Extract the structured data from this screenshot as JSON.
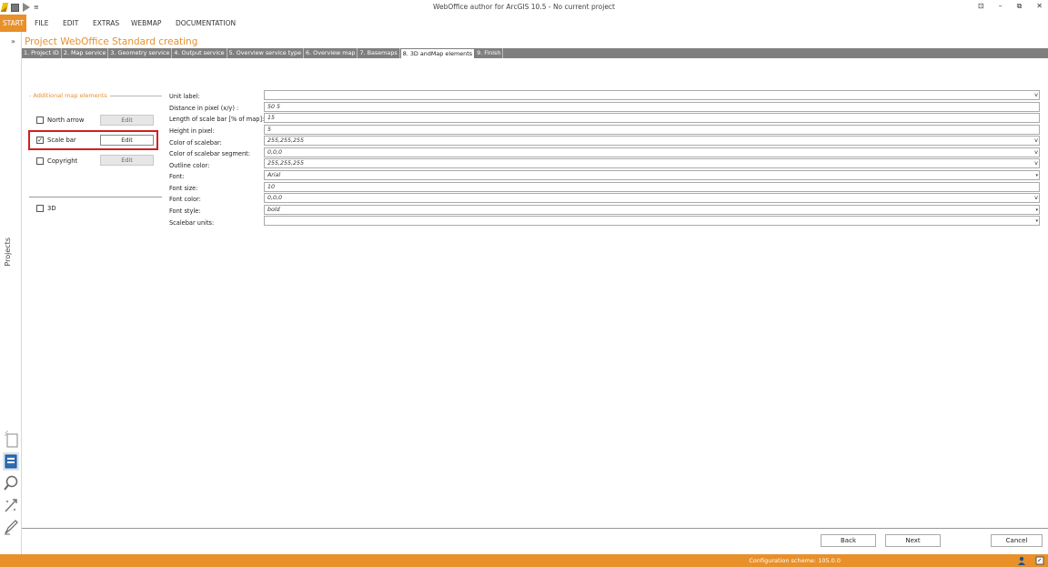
{
  "window": {
    "title": "WebOffice author for ArcGIS 10.5 - No current project",
    "controls": [
      "⊡",
      "–",
      "⧉",
      "✕"
    ]
  },
  "quick_access": {
    "more_label": "≡"
  },
  "menu": {
    "start": "START",
    "items": [
      "FILE",
      "EDIT",
      "EXTRAS",
      "WEBMAP",
      "DOCUMENTATION"
    ]
  },
  "left_rail": {
    "expand_label": "»",
    "projects_label": "Projects"
  },
  "project": {
    "title": "Project WebOffice Standard creating",
    "steps": [
      "1. Project ID",
      "2. Map service",
      "3. Geometry service",
      "4. Output service",
      "5. Overview service type",
      "6. Overview map",
      "7. Basemaps",
      "8. 3D andMap elements",
      "9. Finish"
    ],
    "active_step": 7
  },
  "map_elements": {
    "section_title": "- Additional map elements",
    "edit_label": "Edit",
    "north_arrow": {
      "label": "North arrow",
      "checked": false
    },
    "scale_bar": {
      "label": "Scale bar",
      "checked": true
    },
    "copyright": {
      "label": "Copyright",
      "checked": false
    },
    "three_d": {
      "label": "3D",
      "checked": false
    },
    "check_mark": "✓"
  },
  "form": {
    "unit_label": {
      "label": "Unit label:",
      "value": ""
    },
    "distance": {
      "label": "Distance in pixel (x/y) :",
      "value": "50 5"
    },
    "length": {
      "label": "Length of scale bar [% of map]:",
      "value": "15"
    },
    "height": {
      "label": "Height in pixel:",
      "value": "5"
    },
    "color_scalebar": {
      "label": "Color of scalebar:",
      "value": "255,255,255"
    },
    "color_segment": {
      "label": "Color of scalebar segment:",
      "value": "0,0,0"
    },
    "outline_color": {
      "label": "Outline color:",
      "value": "255,255,255"
    },
    "font": {
      "label": "Font:",
      "value": "Arial"
    },
    "font_size": {
      "label": "Font size:",
      "value": "10"
    },
    "font_color": {
      "label": "Font color:",
      "value": "0,0,0"
    },
    "font_style": {
      "label": "Font style:",
      "value": "bold"
    },
    "scalebar_units": {
      "label": "Scalebar units:",
      "value": ""
    },
    "color_dropdown_glyph": "v",
    "combo_dropdown_glyph": "▾"
  },
  "buttons": {
    "back": "Back",
    "next": "Next",
    "cancel": "Cancel"
  },
  "status": {
    "configuration": "Configuration scheme:  105.0.0"
  },
  "colors": {
    "accent": "#e8902a",
    "highlight": "#d21f1f",
    "tabstrip": "#7f7f7f"
  }
}
